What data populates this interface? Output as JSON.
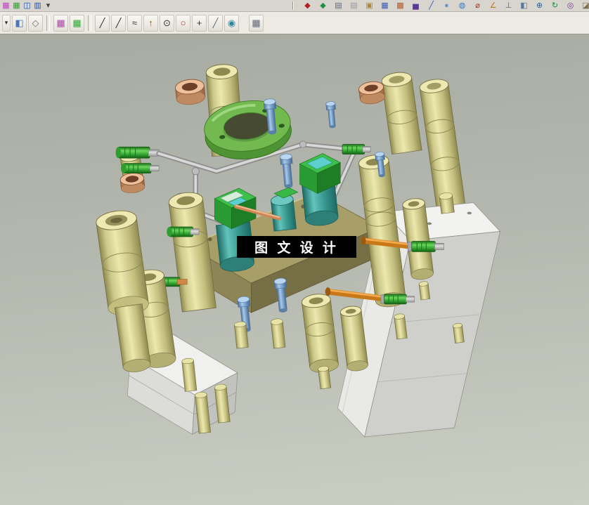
{
  "app": {
    "type": "cad-3d-modeling",
    "viewport_background_top": "#a7aba1",
    "viewport_background_bottom": "#cacec3"
  },
  "watermark": {
    "text": "图 文 设 计",
    "background": "#000000",
    "color": "#ffffff"
  },
  "toolbar_top": {
    "left_icons": [
      {
        "name": "scene-display-icon",
        "glyph": "▦",
        "color": "#c040c0"
      },
      {
        "name": "layout-grid-icon",
        "glyph": "▦",
        "color": "#30a030"
      },
      {
        "name": "window-split-icon",
        "glyph": "◫",
        "color": "#2050b0"
      },
      {
        "name": "view-panel-icon",
        "glyph": "▥",
        "color": "#2050b0"
      },
      {
        "name": "display-dropdown-icon",
        "glyph": "▾",
        "color": "#404040"
      }
    ],
    "right_icons": [
      {
        "name": "red-part-icon",
        "glyph": "◆",
        "color": "#b02020"
      },
      {
        "name": "green-part-icon",
        "glyph": "◆",
        "color": "#209040"
      },
      {
        "name": "document-icon",
        "glyph": "▤",
        "color": "#5a6a80"
      },
      {
        "name": "document-copy-icon",
        "glyph": "▤",
        "color": "#90989f"
      },
      {
        "name": "folder-icon",
        "glyph": "▣",
        "color": "#b08830"
      },
      {
        "name": "table-grid-icon",
        "glyph": "▦",
        "color": "#3858b8"
      },
      {
        "name": "color-palette-icon",
        "glyph": "▩",
        "color": "#b85820"
      },
      {
        "name": "histogram-icon",
        "glyph": "▅",
        "color": "#5a3898"
      },
      {
        "name": "diagonal-line-icon",
        "glyph": "╱",
        "color": "#2858b8"
      },
      {
        "name": "sphere-icon",
        "glyph": "●",
        "color": "#6898c8"
      },
      {
        "name": "globe-icon",
        "glyph": "◍",
        "color": "#3878b8"
      },
      {
        "name": "diameter-icon",
        "glyph": "⌀",
        "color": "#a83028"
      },
      {
        "name": "angle-measure-icon",
        "glyph": "∠",
        "color": "#b87820"
      },
      {
        "name": "datum-plane-icon",
        "glyph": "⊥",
        "color": "#486078"
      },
      {
        "name": "section-view-icon",
        "glyph": "◧",
        "color": "#5878a0"
      },
      {
        "name": "wcs-icon",
        "glyph": "⊕",
        "color": "#2860a0"
      },
      {
        "name": "refresh-view-icon",
        "glyph": "↻",
        "color": "#208840"
      },
      {
        "name": "camera-view-icon",
        "glyph": "◎",
        "color": "#704090"
      },
      {
        "name": "render-style-icon",
        "glyph": "◪",
        "color": "#807050"
      }
    ]
  },
  "toolbar_sketch": {
    "icons": [
      {
        "name": "view-dropdown-icon",
        "glyph": "▾",
        "color": "#303030",
        "narrow": true
      },
      {
        "name": "shaded-view-icon",
        "glyph": "◧",
        "color": "#4878b8"
      },
      {
        "name": "wireframe-view-icon",
        "glyph": "◇",
        "color": "#707070"
      },
      {
        "sep": true
      },
      {
        "name": "snap-point-grid-icon",
        "glyph": "▦",
        "color": "#b838b8"
      },
      {
        "name": "snap-enable-grid-icon",
        "glyph": "▦",
        "color": "#38a038"
      },
      {
        "sep": true
      },
      {
        "name": "sketch-line-icon",
        "glyph": "╱",
        "color": "#303030"
      },
      {
        "name": "sketch-profile-icon",
        "glyph": "╱",
        "color": "#303030"
      },
      {
        "name": "sketch-spline-icon",
        "glyph": "≈",
        "color": "#303030"
      },
      {
        "name": "datum-axis-icon",
        "glyph": "↑",
        "color": "#806020"
      },
      {
        "name": "circle-center-icon",
        "glyph": "⊙",
        "color": "#303030"
      },
      {
        "name": "sketch-circle-icon",
        "glyph": "○",
        "color": "#b03030"
      },
      {
        "name": "point-tool-icon",
        "glyph": "+",
        "color": "#303030"
      },
      {
        "name": "line-point-icon",
        "glyph": "╱",
        "color": "#607080"
      },
      {
        "name": "quick-pick-icon",
        "glyph": "◉",
        "color": "#2888a0"
      },
      {
        "gap": true
      },
      {
        "name": "grid-toggle-icon",
        "glyph": "▦",
        "color": "#5a6878"
      }
    ]
  },
  "model": {
    "palette": {
      "guide_pillar": "#d6d190",
      "guide_bushing": "#eec09c",
      "locating_ring": "#72ba50",
      "insert_block": "#3cc04a",
      "core_cylinder": "#3a9c94",
      "mold_plate": "#a89f68",
      "mold_base_block": "#efefec",
      "cooling_pipe_orange": "#d07820",
      "hose_fitting": "#3fae3f",
      "water_pipe_gray": "#c6c6c6",
      "cap_screw": "#a9c9e9"
    },
    "parts": [
      "locating-ring",
      "guide-pillars",
      "guide-bushings",
      "core-inserts",
      "upper-mold-plate",
      "mold-base-blocks",
      "cooling-pipes",
      "hose-fittings",
      "cap-screws",
      "ejector-pins"
    ]
  }
}
